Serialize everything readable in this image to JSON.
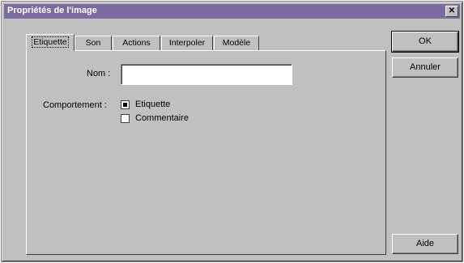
{
  "window": {
    "title": "Propriétés de l'image",
    "close_glyph": "✕"
  },
  "tabs": [
    {
      "label": "Etiquette",
      "active": true
    },
    {
      "label": "Son",
      "active": false
    },
    {
      "label": "Actions",
      "active": false
    },
    {
      "label": "Interpoler",
      "active": false
    },
    {
      "label": "Modèle",
      "active": false
    }
  ],
  "form": {
    "name_label": "Nom :",
    "name_value": "",
    "behavior_label": "Comportement :",
    "options": [
      {
        "label": "Etiquette",
        "checked": true
      },
      {
        "label": "Commentaire",
        "checked": false
      }
    ]
  },
  "buttons": {
    "ok": "OK",
    "cancel": "Annuler",
    "help": "Aide"
  }
}
